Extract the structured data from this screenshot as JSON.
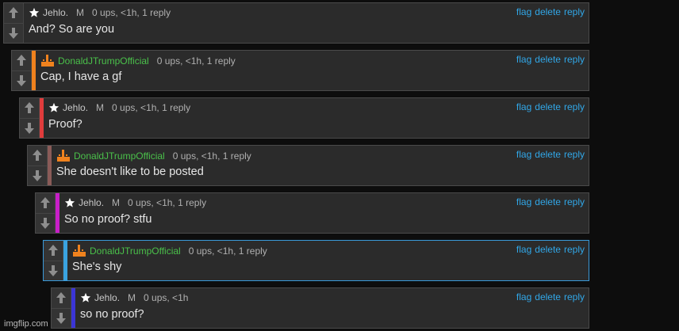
{
  "comments": [
    {
      "username": "Jehlo.",
      "gender": "M",
      "stats": "0 ups, <1h, 1 reply",
      "text": "And? So are you",
      "user_icon": "star-icon",
      "bar_color": ""
    },
    {
      "username": "DonaldJTrumpOfficial",
      "gender": "",
      "stats": "0 ups, <1h, 1 reply",
      "text": "Cap, I have a gf",
      "user_icon": "orange-hand-icon",
      "bar_color": "#f0821e"
    },
    {
      "username": "Jehlo.",
      "gender": "M",
      "stats": "0 ups, <1h, 1 reply",
      "text": "Proof?",
      "user_icon": "star-icon",
      "bar_color": "#e03c3c"
    },
    {
      "username": "DonaldJTrumpOfficial",
      "gender": "",
      "stats": "0 ups, <1h, 1 reply",
      "text": "She doesn't like to be posted",
      "user_icon": "orange-hand-icon",
      "bar_color": "#8a5b58"
    },
    {
      "username": "Jehlo.",
      "gender": "M",
      "stats": "0 ups, <1h, 1 reply",
      "text": "So no proof? stfu",
      "user_icon": "star-icon",
      "bar_color": "#c81ec8"
    },
    {
      "username": "DonaldJTrumpOfficial",
      "gender": "",
      "stats": "0 ups, <1h, 1 reply",
      "text": "She's shy",
      "user_icon": "orange-hand-icon",
      "bar_color": "#3aa3e0"
    },
    {
      "username": "Jehlo.",
      "gender": "M",
      "stats": "0 ups, <1h",
      "text": "so no proof?",
      "user_icon": "star-icon",
      "bar_color": "#3b35d6"
    }
  ],
  "actions": {
    "flag": "flag",
    "delete": "delete",
    "reply": "reply"
  },
  "colors": {
    "link": "#31a7e8",
    "green_username": "#4ac04a",
    "highlight_border": "#3a9ad9"
  },
  "watermark": "imgflip.com"
}
